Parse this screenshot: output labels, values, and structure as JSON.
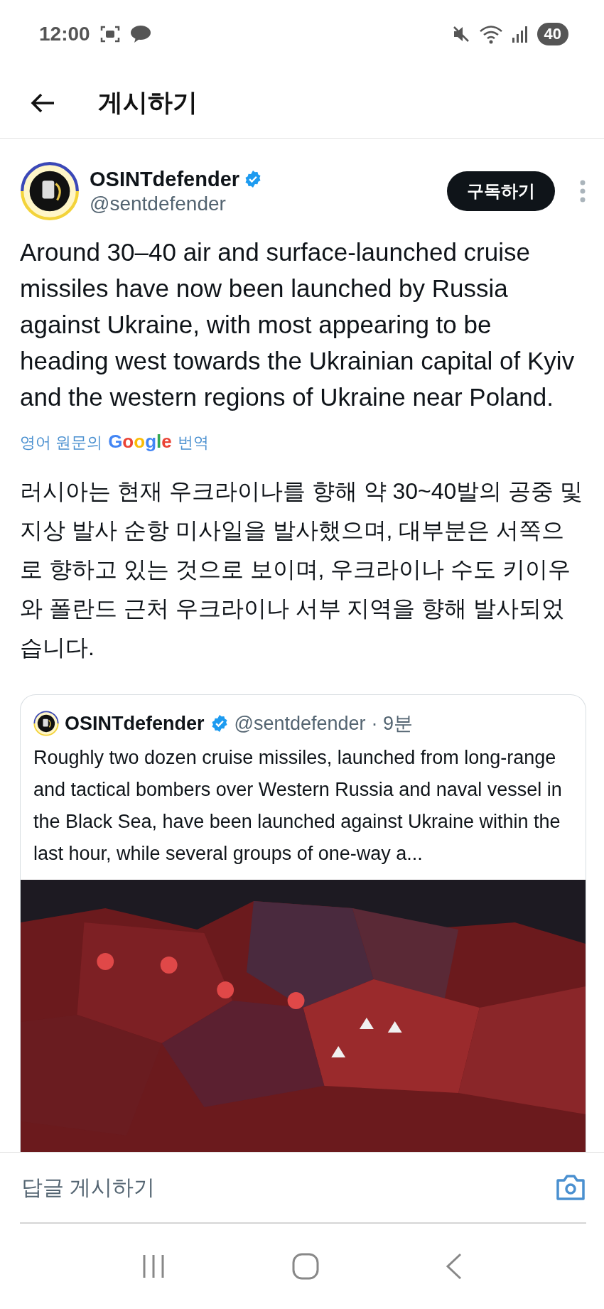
{
  "status_bar": {
    "time": "12:00",
    "battery": "40"
  },
  "header": {
    "title": "게시하기"
  },
  "post": {
    "author": {
      "name": "OSINTdefender",
      "handle": "@sentdefender",
      "verified": true
    },
    "subscribe_button": "구독하기",
    "text": "Around 30–40 air and surface-launched cruise missiles have now been launched by Russia against Ukraine, with most appearing to be heading west towards the Ukrainian capital of Kyiv and the western regions of Ukraine near Poland.",
    "translation_link": {
      "prefix": "영어 원문의",
      "brand": "Google",
      "suffix": "번역"
    },
    "translated_text": "러시아는 현재 우크라이나를 향해 약 30~40발의 공중 및 지상 발사 순항 미사일을 발사했으며, 대부분은 서쪽으로 향하고 있는 것으로 보이며, 우크라이나 수도 키이우와 폴란드 근처 우크라이나 서부 지역을 향해 발사되었습니다.",
    "quoted_post": {
      "name": "OSINTdefender",
      "verified": true,
      "handle": "@sentdefender",
      "time": "· 9분",
      "text": "Roughly two dozen cruise missiles, launched from long-range and tactical bombers over Western Russia and naval vessel in the Black Sea, have been launched against Ukraine within the last hour, while several groups of one-way a..."
    }
  },
  "reply_bar": {
    "placeholder": "답글 게시하기"
  }
}
